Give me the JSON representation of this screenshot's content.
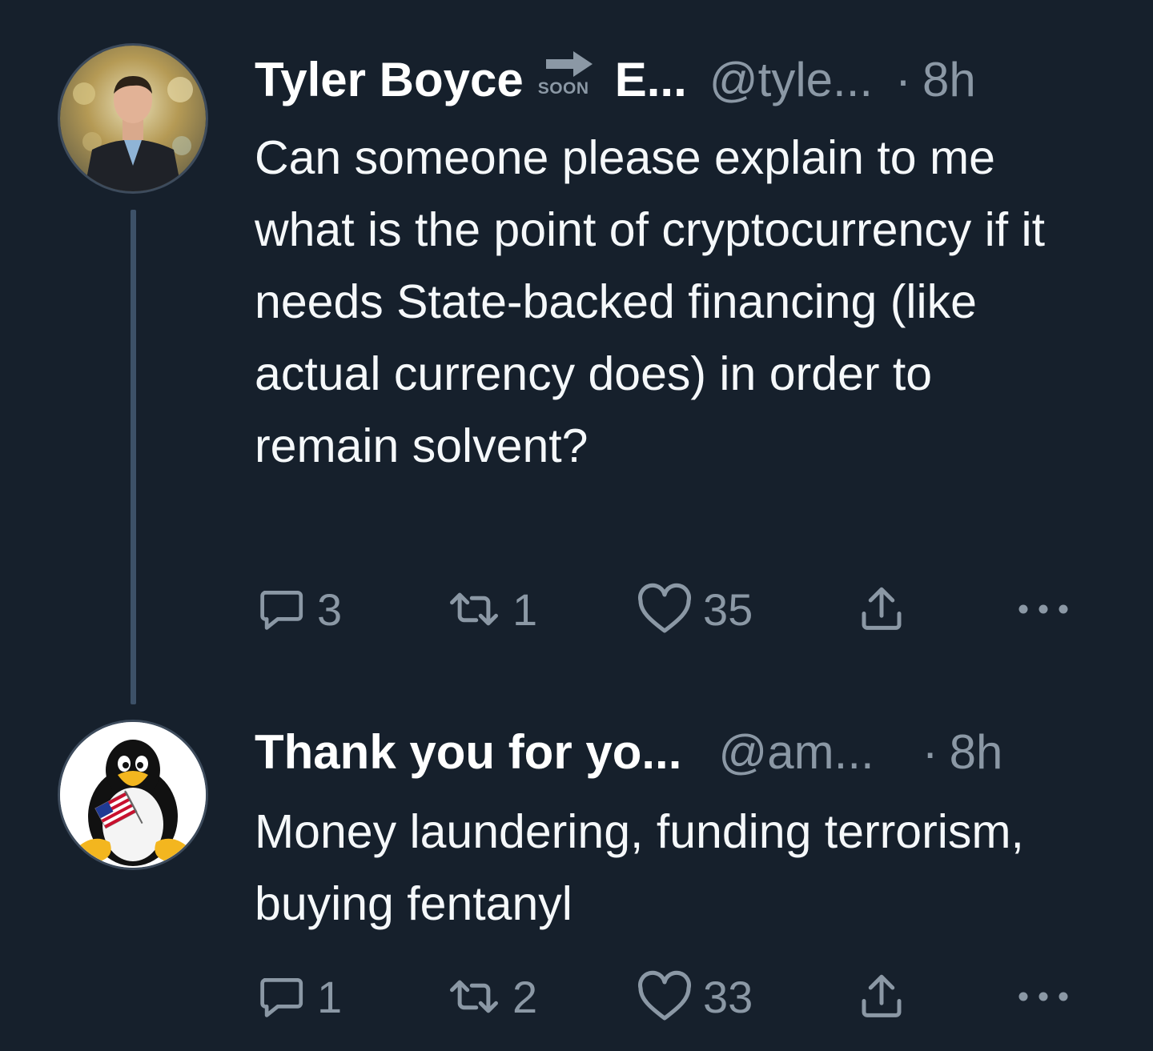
{
  "tweets": [
    {
      "display_name": "Tyler Boyce",
      "badge_text": "SOON",
      "name_suffix": "E...",
      "handle": "@tyle...",
      "separator": "·",
      "time": "8h",
      "text": "Can someone please explain to me what is the point of cryptocurrency if it needs State-backed financing (like actual currency does) in order to remain solvent?",
      "replies": "3",
      "retweets": "1",
      "likes": "35",
      "avatar": "man-in-suit-avatar"
    },
    {
      "display_name": "Thank you for yo...",
      "handle": "@am...",
      "separator": "·",
      "time": "8h",
      "text": "Money laundering, funding terrorism, buying fentanyl",
      "replies": "1",
      "retweets": "2",
      "likes": "33",
      "avatar": "penguin-with-flag-avatar"
    }
  ],
  "icons": {
    "reply": "reply-icon",
    "retweet": "retweet-icon",
    "like": "heart-icon",
    "share": "share-icon",
    "more": "more-icon"
  },
  "colors": {
    "background": "#16202c",
    "secondary_text": "#8b98a5",
    "primary_text": "#ffffff"
  }
}
